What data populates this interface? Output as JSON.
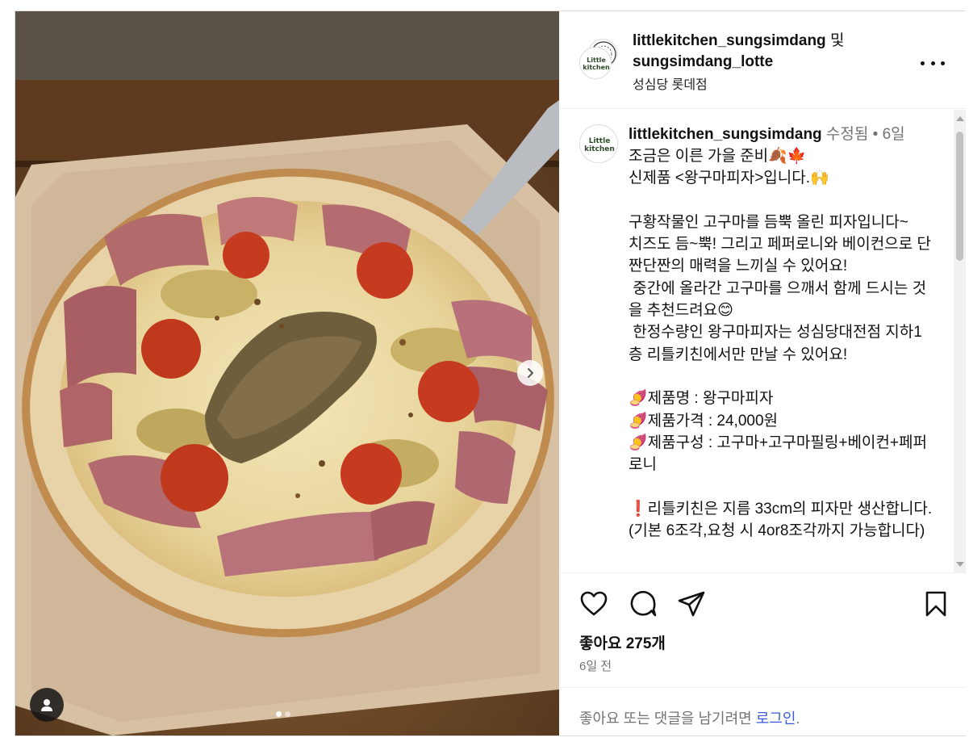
{
  "post": {
    "author": "littlekitchen_sungsimdang",
    "and_word": "및",
    "collaborator": "sungsimdang_lotte",
    "location": "성심당 롯데점",
    "avatar_text_1": "Little",
    "avatar_text_2": "kitchen"
  },
  "caption": {
    "username": "littlekitchen_sungsimdang",
    "meta": " 수정됨 • 6일",
    "text": "조금은 이른 가을 준비🍂🍁\n신제품 <왕구마피자>입니다.🙌\n\n구황작물인 고구마를 듬뿍 올린 피자입니다~\n치즈도 듬~뿍! 그리고 페퍼로니와 베이컨으로 단짠단짠의 매력을 느끼실 수 있어요!\n 중간에 올라간 고구마를 으깨서 함께 드시는 것을 추천드려요😊\n 한정수량인 왕구마피자는 성심당대전점 지하1층 리틀키친에서만 만날 수 있어요!\n\n🍠제품명 : 왕구마피자\n🍠제품가격 : 24,000원\n🍠제품구성 : 고구마+고구마필링+베이컨+페퍼로니\n\n❗리틀키친은 지름 33cm의 피자만 생산합니다.(기본 6조각,요청 시 4or8조각까지 가능합니다)"
  },
  "stats": {
    "likes": "좋아요 275개",
    "time_ago": "6일 전"
  },
  "login_prompt": {
    "text": "좋아요 또는 댓글을 남기려면 ",
    "link": "로그인",
    "suffix": "."
  },
  "carousel": {
    "current": 1,
    "total": 2
  },
  "icons": {
    "like": "heart-icon",
    "comment": "comment-icon",
    "share": "share-icon",
    "save": "bookmark-icon",
    "more": "more-icon",
    "next": "chevron-right-icon",
    "tag": "user-tag-icon"
  },
  "colors": {
    "link": "#3b5bdb",
    "secondary_text": "#737373",
    "border": "#dbdbdb"
  }
}
